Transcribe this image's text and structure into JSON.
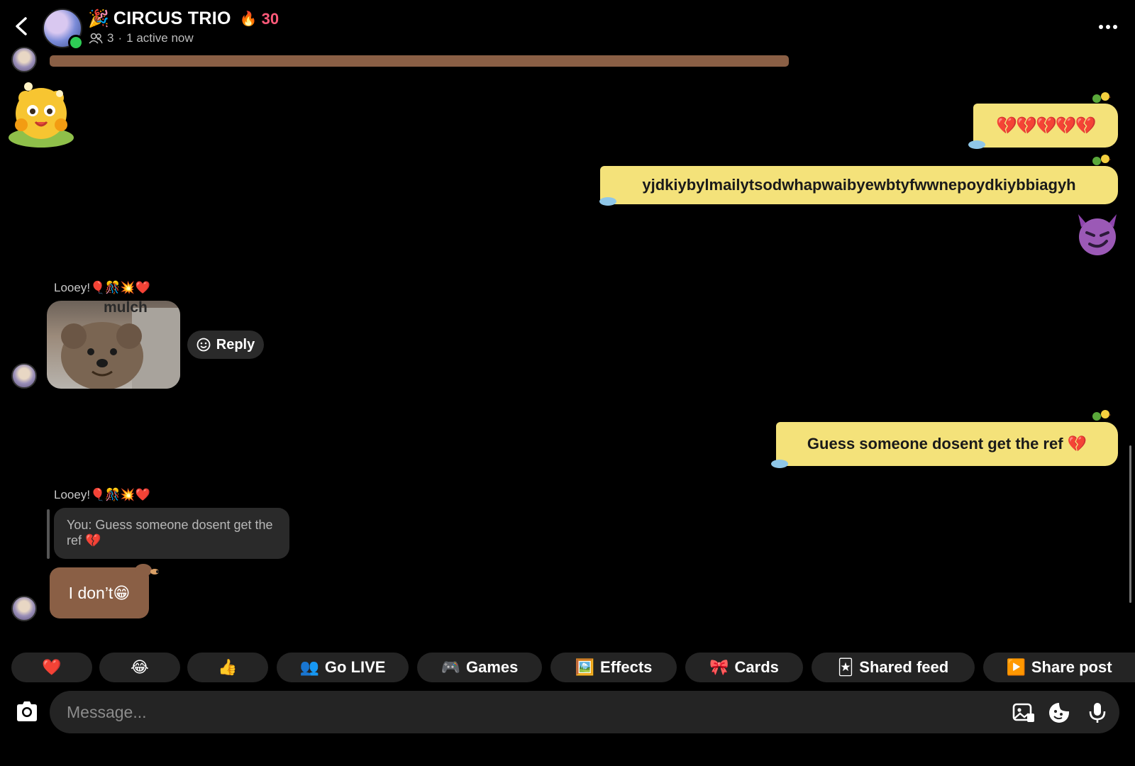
{
  "header": {
    "title": "CIRCUS TRIO",
    "title_emoji": "🎉",
    "streak_emoji": "🔥",
    "streak_count": "30",
    "member_count": "3",
    "status": "1 active now"
  },
  "messages": {
    "sent_1": "💔💔💔💔💔",
    "sent_2": "yjdkiybylmailytsodwhapwaibyewbtyfwwnepoydkiybbiagyh",
    "sent_3": "Guess someone dosent get the ref 💔",
    "sender_name_1": "Looey!🎈🎊💥❤️",
    "image_caption": "mulch",
    "reply_label": "Reply",
    "sender_name_2": "Looey!🎈🎊💥❤️",
    "quote_text": "You: Guess someone dosent get the ref 💔",
    "received_text": "I don’t😁"
  },
  "quick_actions": [
    {
      "icon": "❤️"
    },
    {
      "icon": "😂"
    },
    {
      "icon": "👍"
    },
    {
      "icon": "👥",
      "label": "Go LIVE"
    },
    {
      "icon": "🎮",
      "label": "Games"
    },
    {
      "icon": "🖼️",
      "label": "Effects"
    },
    {
      "icon": "🎀",
      "label": "Cards"
    },
    {
      "icon": "🃏",
      "label": "Shared feed"
    },
    {
      "icon": "▶️",
      "label": "Share post"
    }
  ],
  "composer": {
    "placeholder": "Message..."
  },
  "colors": {
    "sent_bubble": "#f4e27a",
    "received_bubble": "#8a5f45",
    "chip_bg": "#242424",
    "online": "#2ecc55",
    "streak": "#ff5a7a"
  }
}
